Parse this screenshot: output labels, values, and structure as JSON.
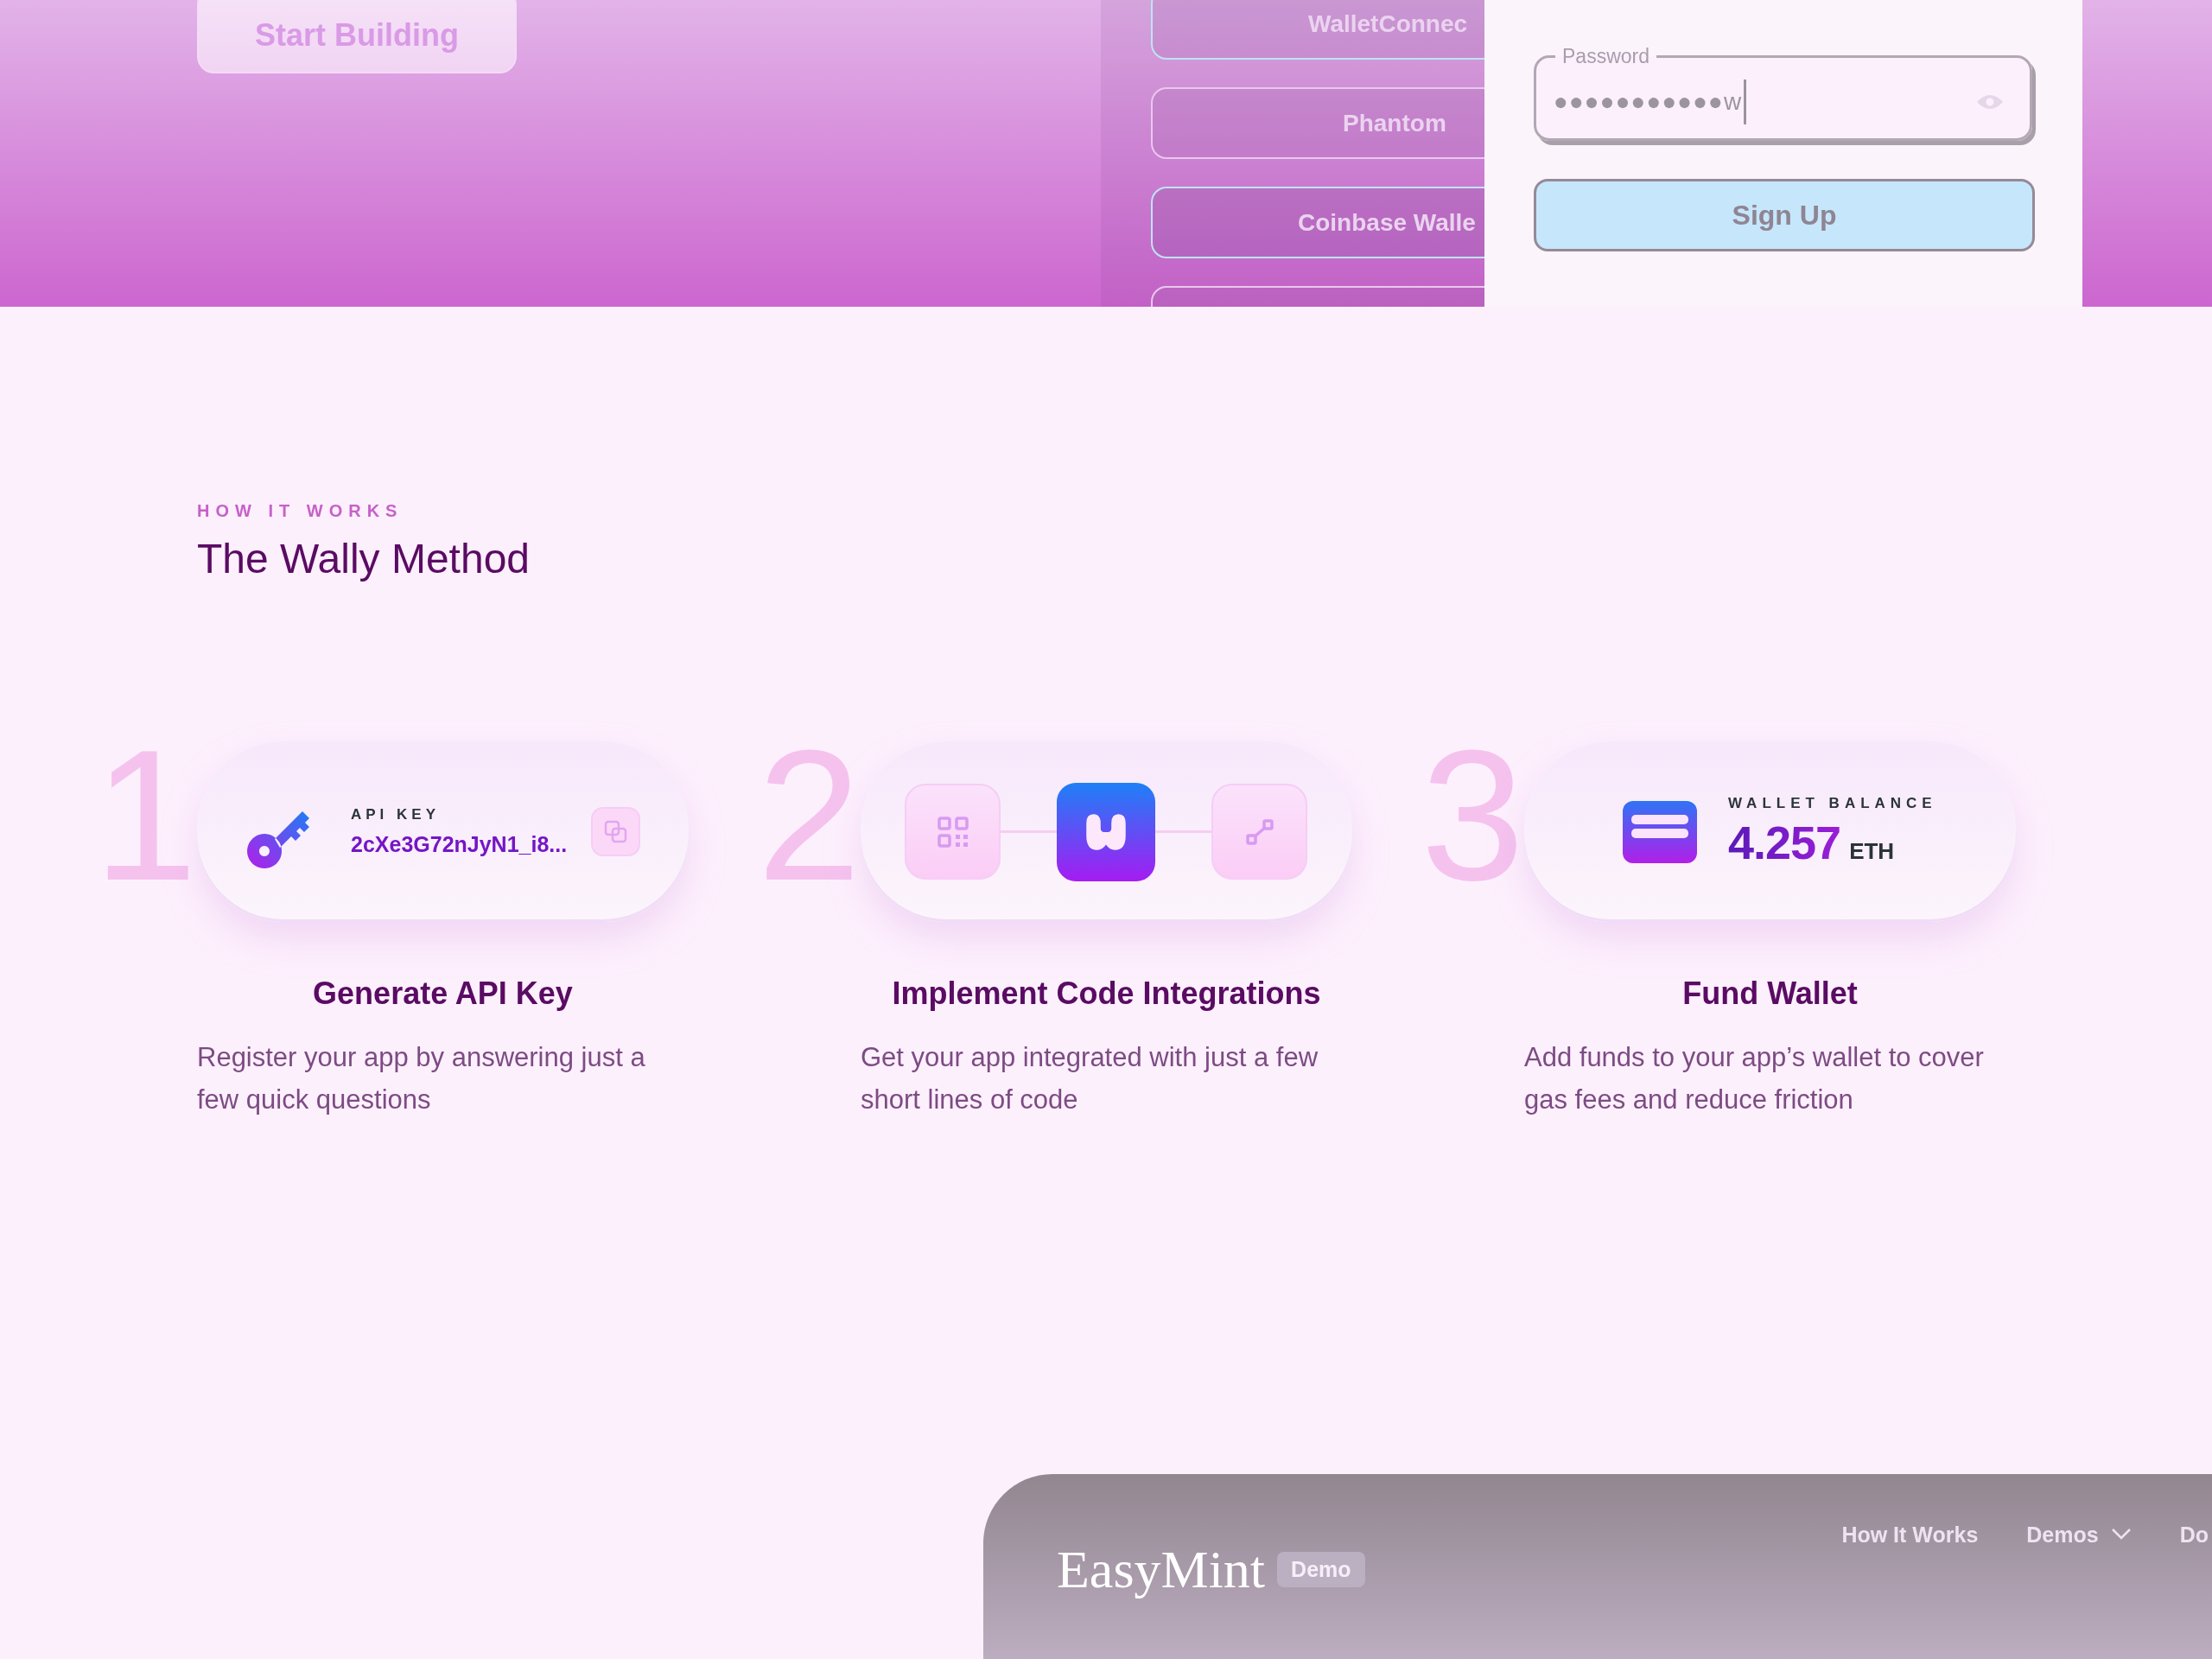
{
  "hero": {
    "start_button": "Start Building",
    "wallet_options": [
      "WalletConnec",
      "Phantom",
      "Coinbase Walle"
    ],
    "signup": {
      "password": {
        "label": "Password",
        "value": "●●●●●●●●●●●w"
      },
      "submit": "Sign Up"
    }
  },
  "how_it_works": {
    "eyebrow": "HOW IT WORKS",
    "title": "The Wally Method",
    "steps": [
      {
        "number": "1",
        "kind": "api_key",
        "label": "API KEY",
        "value": "2cXe3G72nJyN1_i8...",
        "title": "Generate API Key",
        "description": "Register your app by answering just a few quick questions"
      },
      {
        "number": "2",
        "kind": "integration",
        "title": "Implement Code Integrations",
        "description": "Get your app integrated with just a few short lines of code"
      },
      {
        "number": "3",
        "kind": "balance",
        "label": "WALLET BALANCE",
        "value": "4.257",
        "unit": "ETH",
        "title": "Fund Wallet",
        "description": "Add funds to your app’s wallet to cover gas fees and reduce friction"
      }
    ]
  },
  "navbar": {
    "logo": "EasyMint",
    "badge": "Demo",
    "links": [
      {
        "label": "How It Works",
        "kind": "link"
      },
      {
        "label": "Demos",
        "kind": "dropdown"
      },
      {
        "label": "Do",
        "kind": "link"
      }
    ]
  }
}
